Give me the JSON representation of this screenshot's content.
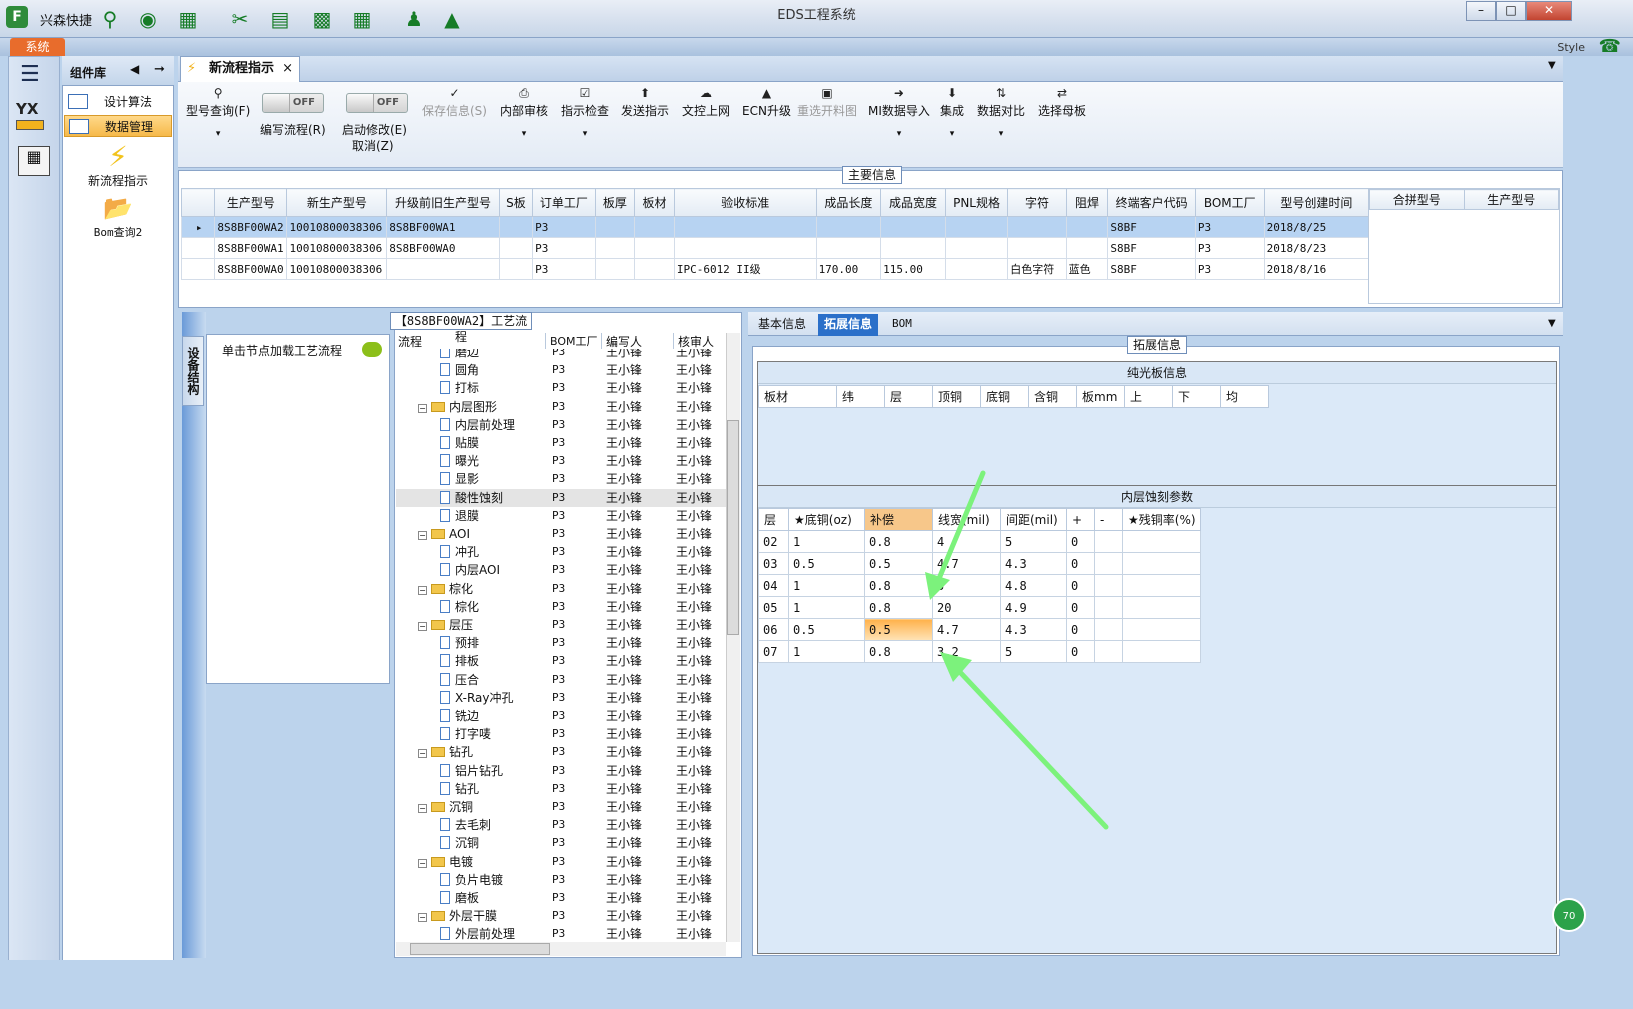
{
  "app": {
    "quick_launch_label": "兴森快捷",
    "window_title": "EDS工程系统",
    "system_tab": "系统",
    "style_label": "Style",
    "logo_letter": "F"
  },
  "component_panel": {
    "title": "组件库",
    "nav_items": [
      {
        "label": "设计算法"
      },
      {
        "label": "数据管理"
      }
    ],
    "big_items": [
      {
        "label": "新流程指示"
      },
      {
        "label": "Bom查询2"
      }
    ],
    "rail_logo": "YX"
  },
  "doc_tab": {
    "label": "新流程指示"
  },
  "toolbar": {
    "model_query": "型号查询(F)",
    "edit_flow": "编写流程(R)",
    "enable_modify": "启动修改(E)",
    "cancel": "取消(Z)",
    "toggle_off": "OFF",
    "save_info": "保存信息(S)",
    "internal_review": "内部审核",
    "instruction_check": "指示检查",
    "send_instruction": "发送指示",
    "upload_doc": "文控上网",
    "ecn_upgrade": "ECN升级",
    "reselect_panel": "重选开料图",
    "mi_import": "MI数据导入",
    "integrate": "集成",
    "data_compare": "数据对比",
    "select_mother": "选择母板"
  },
  "main_info": {
    "legend": "主要信息",
    "columns": [
      "生产型号",
      "新生产型号",
      "升级前旧生产型号",
      "S板",
      "订单工厂",
      "板厚",
      "板材",
      "验收标准",
      "成品长度",
      "成品宽度",
      "PNL规格",
      "字符",
      "阻焊",
      "终端客户代码",
      "BOM工厂",
      "型号创建时间"
    ],
    "rows": [
      [
        "8S8BF00WA2",
        "10010800038306",
        "8S8BF00WA1",
        "",
        "P3",
        "",
        "",
        "",
        "",
        "",
        "",
        "",
        "",
        "S8BF",
        "P3",
        "2018/8/25"
      ],
      [
        "8S8BF00WA1",
        "10010800038306",
        "8S8BF00WA0",
        "",
        "P3",
        "",
        "",
        "",
        "",
        "",
        "",
        "",
        "",
        "S8BF",
        "P3",
        "2018/8/23"
      ],
      [
        "8S8BF00WA0",
        "10010800038306",
        "",
        "",
        "P3",
        "",
        "",
        "IPC-6012 II级",
        "170.00",
        "115.00",
        "",
        "白色字符",
        "蓝色",
        "S8BF",
        "P3",
        "2018/8/16"
      ]
    ],
    "merge_columns": [
      "合拼型号",
      "生产型号"
    ]
  },
  "side": {
    "vertical_tab": "设备结构",
    "hint": "单击节点加载工艺流程"
  },
  "process_tree": {
    "legend": "【8S8BF00WA2】工艺流程",
    "columns": [
      "流程",
      "BOM工厂",
      "编写人",
      "核审人"
    ],
    "rows": [
      {
        "name": "磨边",
        "level": 2,
        "type": "file",
        "bom": "P3",
        "writer": "王小锋",
        "reviewer": "王小锋"
      },
      {
        "name": "圆角",
        "level": 2,
        "type": "file",
        "bom": "P3",
        "writer": "王小锋",
        "reviewer": "王小锋"
      },
      {
        "name": "打标",
        "level": 2,
        "type": "file",
        "bom": "P3",
        "writer": "王小锋",
        "reviewer": "王小锋"
      },
      {
        "name": "内层图形",
        "level": 1,
        "type": "folder",
        "bom": "P3",
        "writer": "王小锋",
        "reviewer": "王小锋"
      },
      {
        "name": "内层前处理",
        "level": 2,
        "type": "file",
        "bom": "P3",
        "writer": "王小锋",
        "reviewer": "王小锋"
      },
      {
        "name": "贴膜",
        "level": 2,
        "type": "file",
        "bom": "P3",
        "writer": "王小锋",
        "reviewer": "王小锋"
      },
      {
        "name": "曝光",
        "level": 2,
        "type": "file",
        "bom": "P3",
        "writer": "王小锋",
        "reviewer": "王小锋"
      },
      {
        "name": "显影",
        "level": 2,
        "type": "file",
        "bom": "P3",
        "writer": "王小锋",
        "reviewer": "王小锋"
      },
      {
        "name": "酸性蚀刻",
        "level": 2,
        "type": "file",
        "bom": "P3",
        "writer": "王小锋",
        "reviewer": "王小锋",
        "highlight": true
      },
      {
        "name": "退膜",
        "level": 2,
        "type": "file",
        "bom": "P3",
        "writer": "王小锋",
        "reviewer": "王小锋"
      },
      {
        "name": "AOI",
        "level": 1,
        "type": "folder",
        "bom": "P3",
        "writer": "王小锋",
        "reviewer": "王小锋"
      },
      {
        "name": "冲孔",
        "level": 2,
        "type": "file",
        "bom": "P3",
        "writer": "王小锋",
        "reviewer": "王小锋"
      },
      {
        "name": "内层AOI",
        "level": 2,
        "type": "file",
        "bom": "P3",
        "writer": "王小锋",
        "reviewer": "王小锋"
      },
      {
        "name": "棕化",
        "level": 1,
        "type": "folder",
        "bom": "P3",
        "writer": "王小锋",
        "reviewer": "王小锋"
      },
      {
        "name": "棕化",
        "level": 2,
        "type": "file",
        "bom": "P3",
        "writer": "王小锋",
        "reviewer": "王小锋"
      },
      {
        "name": "层压",
        "level": 1,
        "type": "folder",
        "bom": "P3",
        "writer": "王小锋",
        "reviewer": "王小锋"
      },
      {
        "name": "预排",
        "level": 2,
        "type": "file",
        "bom": "P3",
        "writer": "王小锋",
        "reviewer": "王小锋"
      },
      {
        "name": "排板",
        "level": 2,
        "type": "file",
        "bom": "P3",
        "writer": "王小锋",
        "reviewer": "王小锋"
      },
      {
        "name": "压合",
        "level": 2,
        "type": "file",
        "bom": "P3",
        "writer": "王小锋",
        "reviewer": "王小锋"
      },
      {
        "name": "X-Ray冲孔",
        "level": 2,
        "type": "file",
        "bom": "P3",
        "writer": "王小锋",
        "reviewer": "王小锋"
      },
      {
        "name": "铣边",
        "level": 2,
        "type": "file",
        "bom": "P3",
        "writer": "王小锋",
        "reviewer": "王小锋"
      },
      {
        "name": "打字唛",
        "level": 2,
        "type": "file",
        "bom": "P3",
        "writer": "王小锋",
        "reviewer": "王小锋"
      },
      {
        "name": "钻孔",
        "level": 1,
        "type": "folder",
        "bom": "P3",
        "writer": "王小锋",
        "reviewer": "王小锋"
      },
      {
        "name": "铝片钻孔",
        "level": 2,
        "type": "file",
        "bom": "P3",
        "writer": "王小锋",
        "reviewer": "王小锋"
      },
      {
        "name": "钻孔",
        "level": 2,
        "type": "file",
        "bom": "P3",
        "writer": "王小锋",
        "reviewer": "王小锋"
      },
      {
        "name": "沉铜",
        "level": 1,
        "type": "folder",
        "bom": "P3",
        "writer": "王小锋",
        "reviewer": "王小锋"
      },
      {
        "name": "去毛刺",
        "level": 2,
        "type": "file",
        "bom": "P3",
        "writer": "王小锋",
        "reviewer": "王小锋"
      },
      {
        "name": "沉铜",
        "level": 2,
        "type": "file",
        "bom": "P3",
        "writer": "王小锋",
        "reviewer": "王小锋"
      },
      {
        "name": "电镀",
        "level": 1,
        "type": "folder",
        "bom": "P3",
        "writer": "王小锋",
        "reviewer": "王小锋"
      },
      {
        "name": "负片电镀",
        "level": 2,
        "type": "file",
        "bom": "P3",
        "writer": "王小锋",
        "reviewer": "王小锋"
      },
      {
        "name": "磨板",
        "level": 2,
        "type": "file",
        "bom": "P3",
        "writer": "王小锋",
        "reviewer": "王小锋"
      },
      {
        "name": "外层干膜",
        "level": 1,
        "type": "folder",
        "bom": "P3",
        "writer": "王小锋",
        "reviewer": "王小锋"
      },
      {
        "name": "外层前处理",
        "level": 2,
        "type": "file",
        "bom": "P3",
        "writer": "王小锋",
        "reviewer": "王小锋"
      }
    ]
  },
  "right": {
    "tabs": [
      "基本信息",
      "拓展信息",
      "BOM"
    ],
    "active_tab": 1,
    "ext_legend": "拓展信息",
    "bare_board": {
      "title": "纯光板信息",
      "columns": [
        "板材",
        "纬",
        "层",
        "顶铜",
        "底铜",
        "含铜",
        "板mm",
        "上",
        "下",
        "均"
      ]
    },
    "inner_etch": {
      "title": "内层蚀刻参数",
      "columns": [
        "层",
        "★底铜(oz)",
        "补偿",
        "线宽(mil)",
        "间距(mil)",
        "+",
        "-",
        "★残铜率(%)"
      ],
      "rows": [
        [
          "02",
          "1",
          "0.8",
          "4",
          "5",
          "0",
          "",
          ""
        ],
        [
          "03",
          "0.5",
          "0.5",
          "4.7",
          "4.3",
          "0",
          "",
          ""
        ],
        [
          "04",
          "1",
          "0.8",
          "5",
          "4.8",
          "0",
          "",
          ""
        ],
        [
          "05",
          "1",
          "0.8",
          "20",
          "4.9",
          "0",
          "",
          ""
        ],
        [
          "06",
          "0.5",
          "0.5",
          "4.7",
          "4.3",
          "0",
          "",
          ""
        ],
        [
          "07",
          "1",
          "0.8",
          "3.2",
          "5",
          "0",
          "",
          ""
        ]
      ],
      "highlight_row": 4,
      "highlight_col": 2
    }
  },
  "badge": "70",
  "colors": {
    "accent": "#2a6fc9",
    "arrow": "#7cf27c",
    "highlight": "#ffb14a",
    "sys_tab": "#e86c2c"
  }
}
